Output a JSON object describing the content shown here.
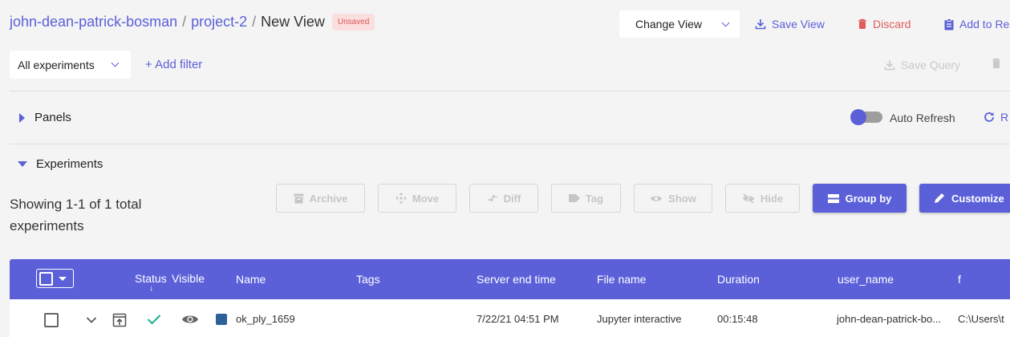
{
  "breadcrumb": {
    "workspace": "john-dean-patrick-bosman",
    "project": "project-2",
    "view": "New View",
    "sep": "/",
    "badge": "Unsaved"
  },
  "header": {
    "change_view": "Change View",
    "save_view": "Save View",
    "discard": "Discard",
    "add_to_report": "Add to Re"
  },
  "filters": {
    "scope": "All experiments",
    "add_filter": "+ Add filter",
    "save_query": "Save Query"
  },
  "panels": {
    "label": "Panels",
    "auto_refresh": "Auto Refresh",
    "refresh": "R"
  },
  "experiments": {
    "label": "Experiments",
    "showing": "Showing 1-1 of 1 total experiments"
  },
  "toolbar": {
    "archive": "Archive",
    "move": "Move",
    "diff": "Diff",
    "tag": "Tag",
    "show": "Show",
    "hide": "Hide",
    "group_by": "Group by",
    "customize": "Customize"
  },
  "table": {
    "columns": {
      "status": "Status",
      "sort_arrow": "↓",
      "visible": "Visible",
      "name": "Name",
      "tags": "Tags",
      "server_end_time": "Server end time",
      "file_name": "File name",
      "duration": "Duration",
      "user_name": "user_name",
      "f": "f"
    },
    "rows": [
      {
        "name": "ok_ply_1659",
        "tags": "",
        "server_end_time": "7/22/21 04:51 PM",
        "file_name": "Jupyter interactive",
        "duration": "00:15:48",
        "user_name": "john-dean-patrick-bo...",
        "f": "C:\\Users\\t"
      }
    ]
  },
  "colors": {
    "accent": "#5b60d9",
    "danger": "#e05c5c",
    "success": "#1aaf8e",
    "row_swatch": "#2f6199"
  }
}
